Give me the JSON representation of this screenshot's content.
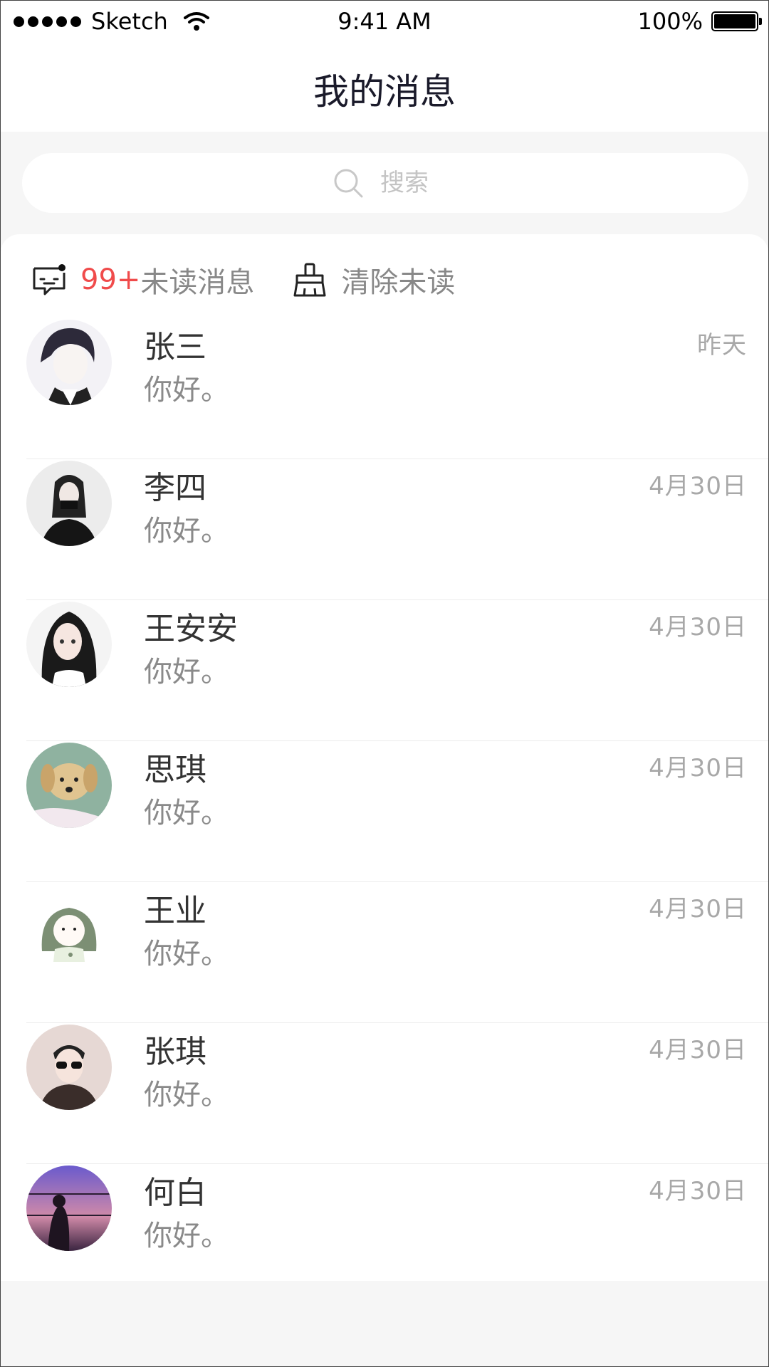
{
  "status_bar": {
    "carrier": "Sketch",
    "time": "9:41 AM",
    "battery": "100%"
  },
  "nav": {
    "title": "我的消息"
  },
  "search": {
    "placeholder": "搜索"
  },
  "toolbar": {
    "unread_count": "99+",
    "unread_label": "未读消息",
    "clear_label": "清除未读"
  },
  "conversations": [
    {
      "name": "张三",
      "message": "你好。",
      "date": "昨天",
      "avatar": "avatar-anime-boy"
    },
    {
      "name": "李四",
      "message": "你好。",
      "date": "4月30日",
      "avatar": "avatar-girl-mask"
    },
    {
      "name": "王安安",
      "message": "你好。",
      "date": "4月30日",
      "avatar": "avatar-anime-girl"
    },
    {
      "name": "思琪",
      "message": "你好。",
      "date": "4月30日",
      "avatar": "avatar-dog"
    },
    {
      "name": "王业",
      "message": "你好。",
      "date": "4月30日",
      "avatar": "avatar-cartoon-girl"
    },
    {
      "name": "张琪",
      "message": "你好。",
      "date": "4月30日",
      "avatar": "avatar-sunglasses-man"
    },
    {
      "name": "何白",
      "message": "你好。",
      "date": "4月30日",
      "avatar": "avatar-sunset-girl"
    }
  ],
  "colors": {
    "accent_unread": "#f04b4b",
    "background": "#f6f6f6"
  }
}
